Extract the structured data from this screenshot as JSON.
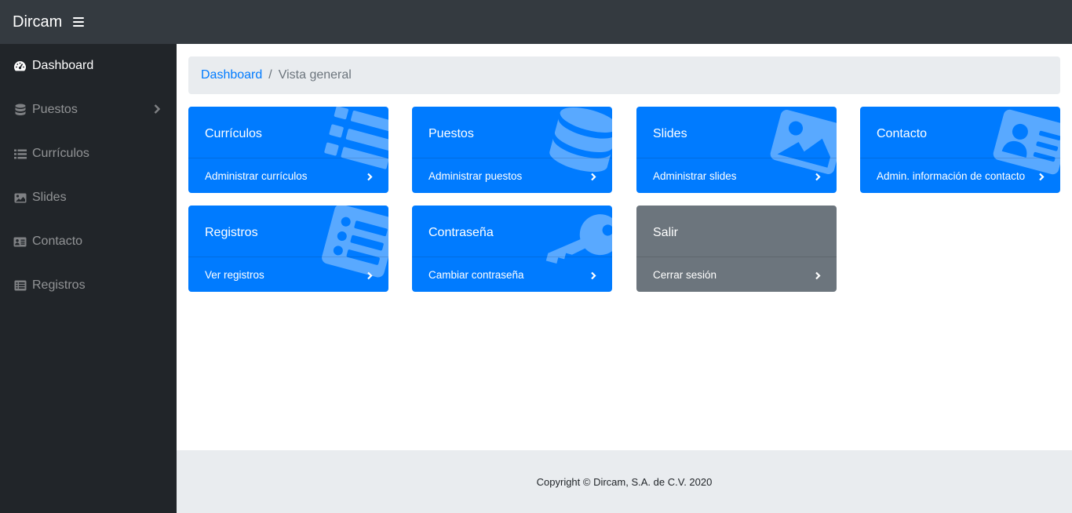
{
  "navbar": {
    "brand": "Dircam",
    "menu_icon": "bars-icon"
  },
  "sidebar": {
    "items": [
      {
        "label": "Dashboard",
        "icon": "tachometer-icon",
        "active": true
      },
      {
        "label": "Puestos",
        "icon": "database-icon",
        "has_submenu": true
      },
      {
        "label": "Currículos",
        "icon": "list-icon"
      },
      {
        "label": "Slides",
        "icon": "image-icon"
      },
      {
        "label": "Contacto",
        "icon": "address-card-icon"
      },
      {
        "label": "Registros",
        "icon": "list-alt-icon"
      }
    ]
  },
  "breadcrumb": {
    "link": "Dashboard",
    "separator": "/",
    "current": "Vista general"
  },
  "cards": [
    {
      "title": "Currículos",
      "footer": "Administrar currículos",
      "icon": "list-icon",
      "color": "#007bff"
    },
    {
      "title": "Puestos",
      "footer": "Administrar puestos",
      "icon": "database-icon",
      "color": "#007bff"
    },
    {
      "title": "Slides",
      "footer": "Administrar slides",
      "icon": "image-icon",
      "color": "#007bff"
    },
    {
      "title": "Contacto",
      "footer": "Admin. información de contacto",
      "icon": "address-card-icon",
      "color": "#007bff"
    },
    {
      "title": "Registros",
      "footer": "Ver registros",
      "icon": "list-alt-icon",
      "color": "#007bff"
    },
    {
      "title": "Contraseña",
      "footer": "Cambiar contraseña",
      "icon": "key-icon",
      "color": "#007bff"
    },
    {
      "title": "Salir",
      "footer": "Cerrar sesión",
      "icon": "",
      "color": "#6c757d"
    }
  ],
  "footer": {
    "copyright": "Copyright © Dircam, S.A. de C.V. 2020"
  },
  "colors": {
    "navbar": "#343a40",
    "sidebar": "#212529",
    "primary": "#007bff",
    "secondary": "#6c757d",
    "light": "#e9ecef"
  }
}
